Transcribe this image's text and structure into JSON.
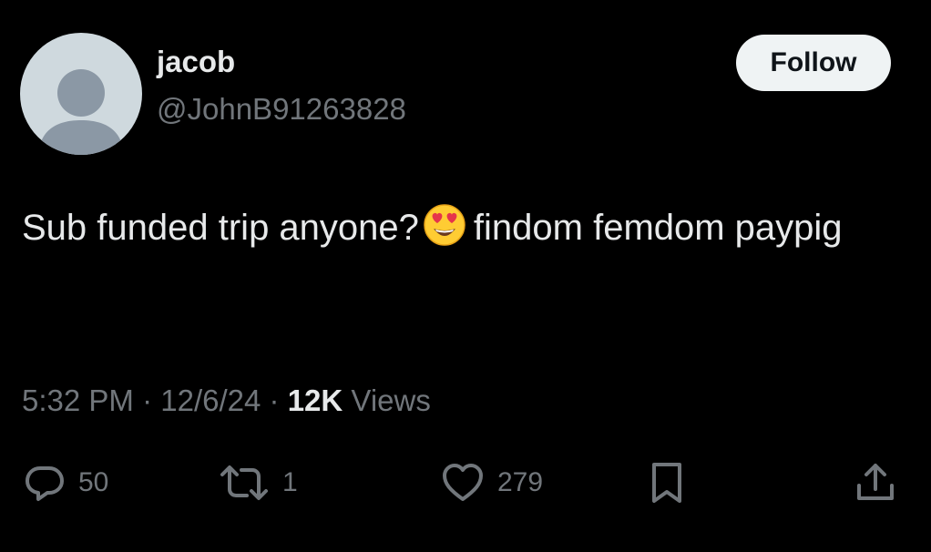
{
  "user": {
    "display_name": "jacob",
    "handle": "@JohnB91263828",
    "follow_label": "Follow"
  },
  "tweet": {
    "text_before": "Sub funded trip anyone?",
    "emoji": "heart-eyes-emoji",
    "text_after": "findom femdom paypig"
  },
  "meta": {
    "time": "5:32 PM",
    "separator": "·",
    "date": "12/6/24",
    "views_count": "12K",
    "views_label": "Views"
  },
  "actions": {
    "replies": "50",
    "reposts": "1",
    "likes": "279"
  },
  "colors": {
    "background": "#000000",
    "primary_text": "#e7e9ea",
    "secondary_text": "#71767b",
    "follow_bg": "#eff3f4",
    "avatar_bg": "#cfd9de"
  }
}
